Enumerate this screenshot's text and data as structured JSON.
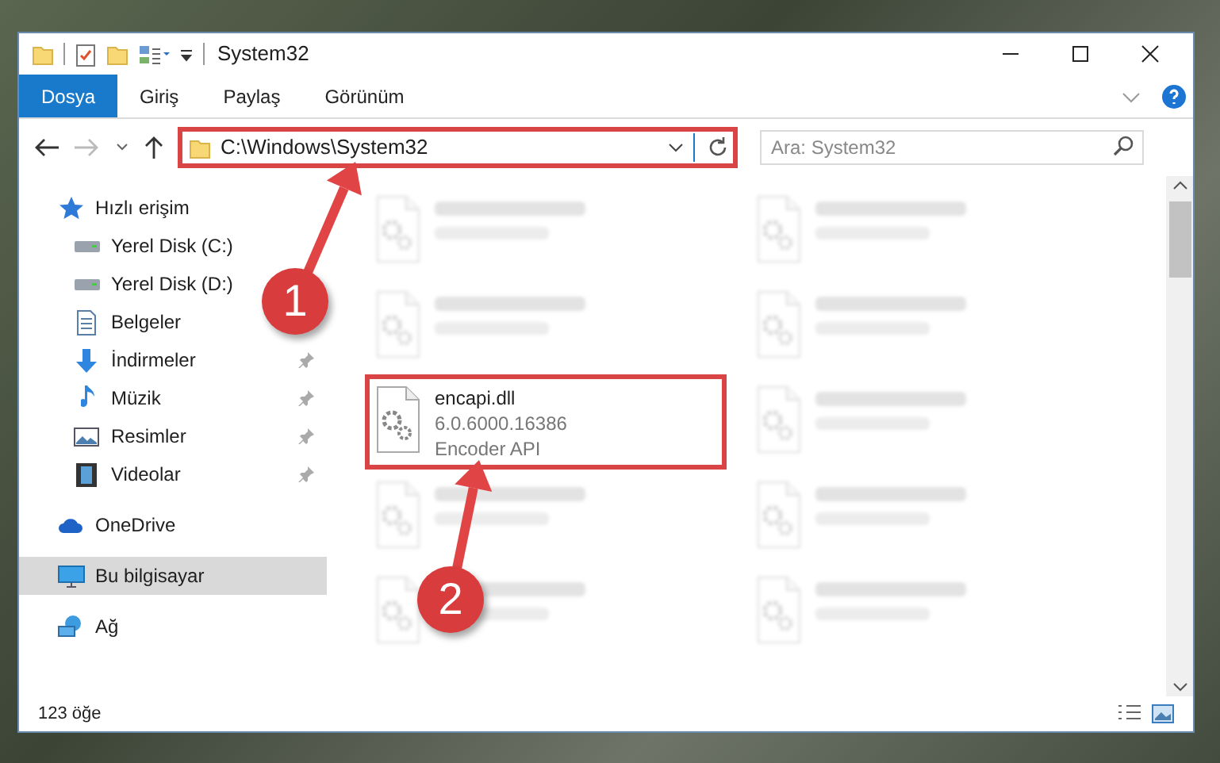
{
  "window": {
    "title": "System32"
  },
  "ribbon_tabs": [
    {
      "label": "Dosya",
      "selected": true
    },
    {
      "label": "Giriş",
      "selected": false
    },
    {
      "label": "Paylaş",
      "selected": false
    },
    {
      "label": "Görünüm",
      "selected": false
    }
  ],
  "address_bar": {
    "value": "C:\\Windows\\System32",
    "highlighted": true
  },
  "search": {
    "placeholder": "Ara: System32"
  },
  "sidebar": {
    "items": [
      {
        "label": "Hızlı erişim",
        "kind": "star",
        "selected": false,
        "children": [
          {
            "label": "Yerel Disk (C:)",
            "kind": "drive",
            "pinned": false,
            "selected": false
          },
          {
            "label": "Yerel Disk (D:)",
            "kind": "drive",
            "pinned": false,
            "selected": false
          },
          {
            "label": "Belgeler",
            "kind": "documents",
            "pinned": false,
            "selected": false
          },
          {
            "label": "İndirmeler",
            "kind": "downloads",
            "pinned": true,
            "selected": false
          },
          {
            "label": "Müzik",
            "kind": "music",
            "pinned": true,
            "selected": false
          },
          {
            "label": "Resimler",
            "kind": "pictures",
            "pinned": true,
            "selected": false
          },
          {
            "label": "Videolar",
            "kind": "videos",
            "pinned": true,
            "selected": false
          }
        ]
      },
      {
        "label": "OneDrive",
        "kind": "cloud",
        "selected": false
      },
      {
        "label": "Bu bilgisayar",
        "kind": "computer",
        "selected": true
      },
      {
        "label": "Ağ",
        "kind": "network",
        "selected": false
      }
    ]
  },
  "files": [
    {
      "blurred": true,
      "highlighted": false
    },
    {
      "blurred": true,
      "highlighted": false
    },
    {
      "blurred": true,
      "highlighted": false
    },
    {
      "blurred": true,
      "highlighted": false
    },
    {
      "name": "encapi.dll",
      "details": [
        "6.0.6000.16386",
        "Encoder API"
      ],
      "blurred": false,
      "highlighted": true
    },
    {
      "blurred": true,
      "highlighted": false
    },
    {
      "blurred": true,
      "highlighted": false
    },
    {
      "blurred": true,
      "highlighted": false
    },
    {
      "blurred": true,
      "highlighted": false
    },
    {
      "blurred": true,
      "highlighted": false
    }
  ],
  "status_bar": {
    "item_count": "123 öğe"
  },
  "callouts": [
    {
      "number": "1"
    },
    {
      "number": "2"
    }
  ]
}
